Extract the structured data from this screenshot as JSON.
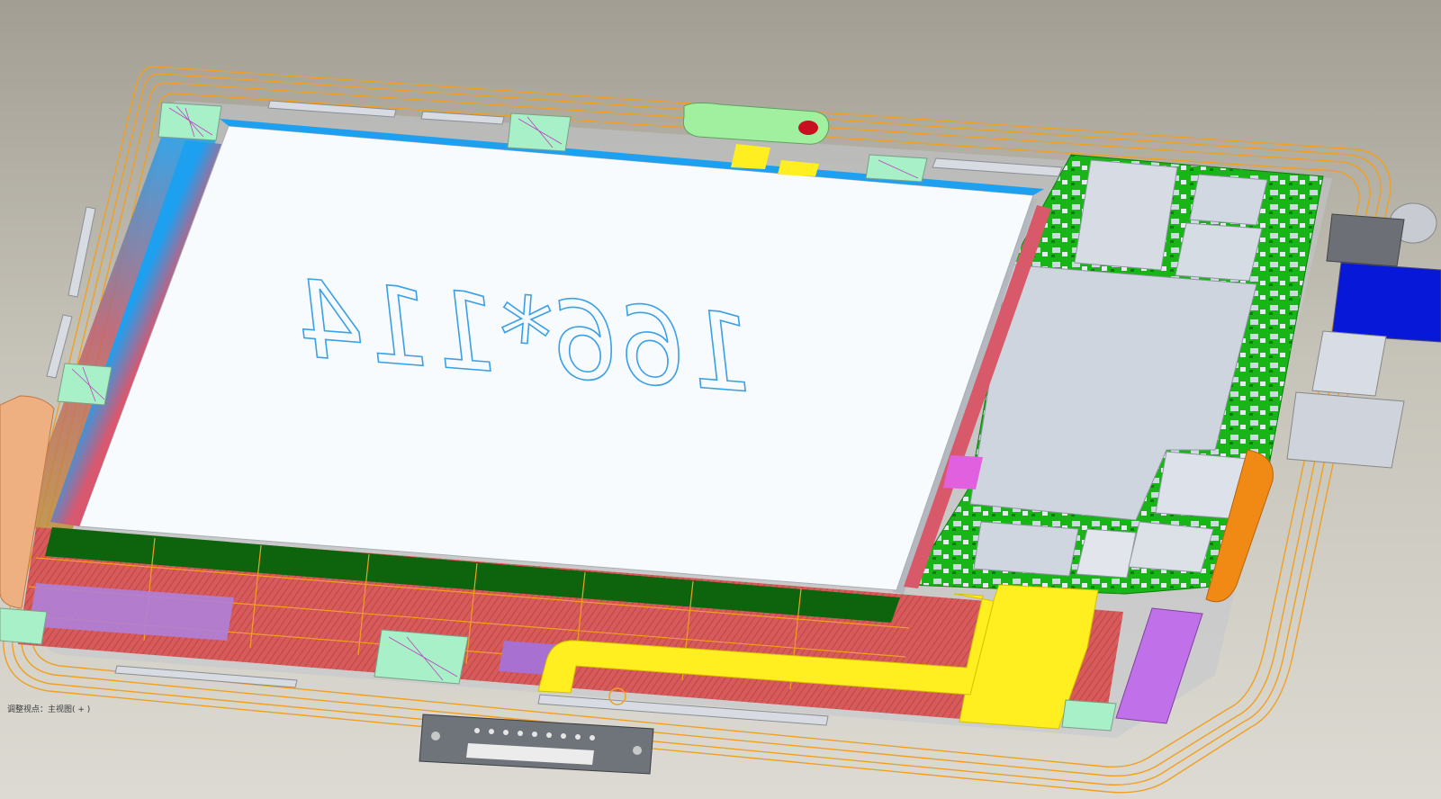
{
  "viewport": {
    "model_annotation": "166*114",
    "status_text": "调整视点：主视图( + )"
  },
  "colors": {
    "background_top": "#a29e94",
    "background_bottom": "#dcdad2",
    "wireframe": "#f0a020",
    "display_panel": "#f8fbfd",
    "display_side": "#c8ccd2",
    "lcd_blue_edge": "#1ea0f0",
    "pcb_green": "#18b418",
    "flex_yellow": "#ffee20",
    "connector_blue": "#0818d8",
    "magenta": "#c060e0",
    "annotation": "#3ca0e6"
  },
  "icons": {
    "component": "pcb-component-icon",
    "connector": "usb-connector-icon",
    "speaker": "speaker-icon"
  }
}
